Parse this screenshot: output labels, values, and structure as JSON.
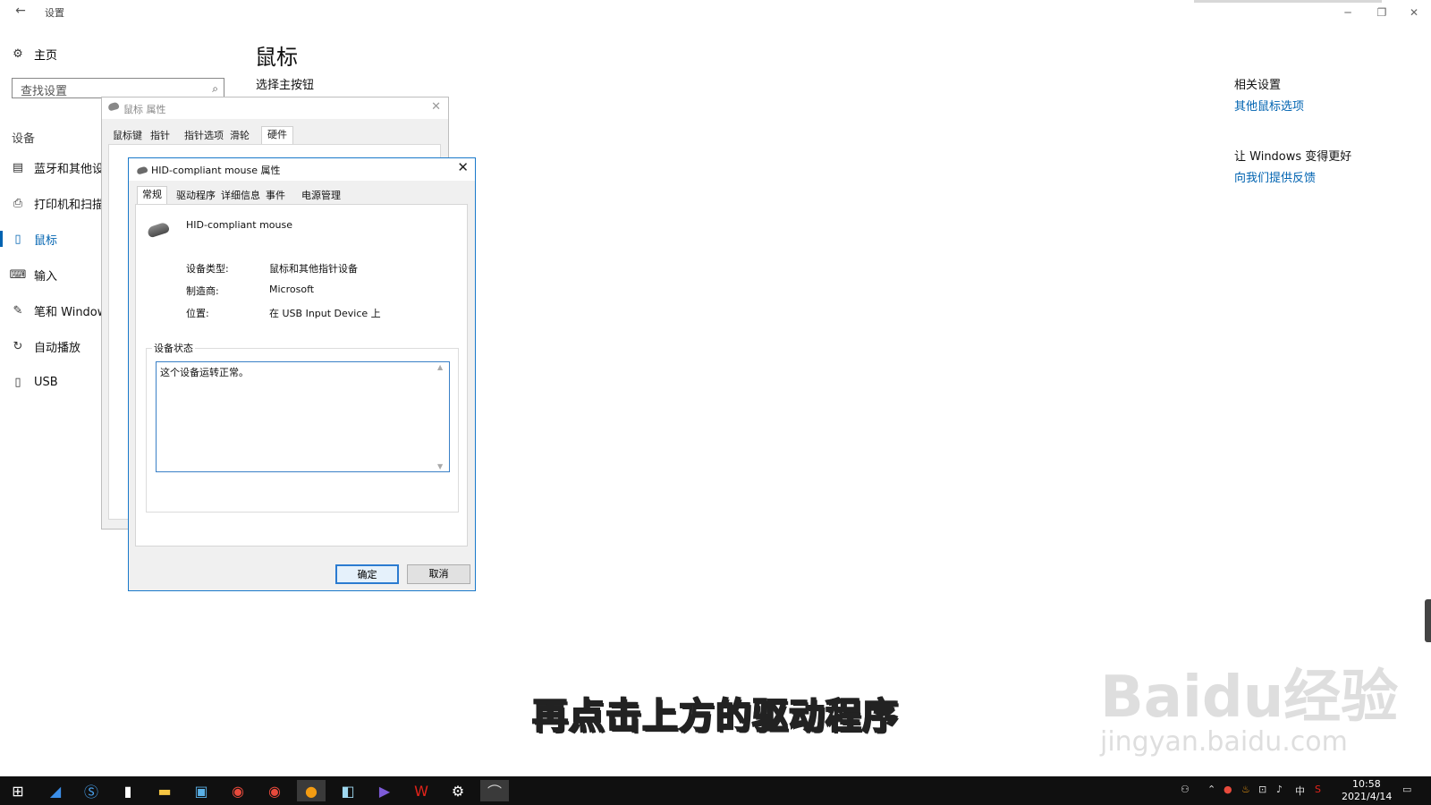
{
  "app": {
    "title": "设置",
    "back_glyph": "←",
    "minimize_glyph": "─",
    "restore_glyph": "❐",
    "close_glyph": "✕"
  },
  "sidebar": {
    "home_label": "主页",
    "search_placeholder": "查找设置",
    "section": "设备",
    "items": [
      {
        "label": "蓝牙和其他设",
        "icon": "keyboard-bluetooth-icon"
      },
      {
        "label": "打印机和扫描",
        "icon": "printer-icon"
      },
      {
        "label": "鼠标",
        "icon": "mouse-icon"
      },
      {
        "label": "输入",
        "icon": "keyboard-icon"
      },
      {
        "label": "笔和 Window",
        "icon": "pen-icon"
      },
      {
        "label": "自动播放",
        "icon": "autoplay-icon"
      },
      {
        "label": "USB",
        "icon": "usb-icon"
      }
    ],
    "active_index": 2
  },
  "main": {
    "page_title": "鼠标",
    "section_label": "选择主按钮"
  },
  "related": {
    "heading": "相关设置",
    "link_mouse_options": "其他鼠标选项",
    "better_heading": "让 Windows 变得更好",
    "link_feedback": "向我们提供反馈"
  },
  "mouse_props_dialog": {
    "title": "鼠标 属性",
    "close_glyph": "✕",
    "tabs": [
      "鼠标键",
      "指针",
      "指针选项",
      "滑轮",
      "硬件"
    ],
    "active_tab_index": 4
  },
  "hid_dialog": {
    "title": "HID-compliant mouse 属性",
    "close_glyph": "✕",
    "tabs": [
      "常规",
      "驱动程序",
      "详细信息",
      "事件",
      "电源管理"
    ],
    "active_tab_index": 0,
    "device_name": "HID-compliant mouse",
    "fields": [
      {
        "label": "设备类型:",
        "value": "鼠标和其他指针设备"
      },
      {
        "label": "制造商:",
        "value": "Microsoft"
      },
      {
        "label": "位置:",
        "value": "在 USB Input Device 上"
      }
    ],
    "status_legend": "设备状态",
    "status_text": "这个设备运转正常。",
    "ok_label": "确定",
    "cancel_label": "取消"
  },
  "caption": "再点击上方的驱动程序",
  "watermark": {
    "logo": "Baidu经验",
    "url": "jingyan.baidu.com"
  },
  "taskbar": {
    "icons": [
      "windows-start-icon",
      "feather-app-icon",
      "s-app-icon",
      "notepad-icon",
      "file-explorer-icon",
      "store-icon",
      "chrome-icon",
      "chrome-profile-icon",
      "chat-app-icon",
      "tablet-app-icon",
      "media-player-icon",
      "wps-icon",
      "settings-gear-icon",
      "mouse-properties-icon"
    ],
    "tray": {
      "ime": "中",
      "time": "10:58",
      "date": "2021/4/14"
    }
  }
}
